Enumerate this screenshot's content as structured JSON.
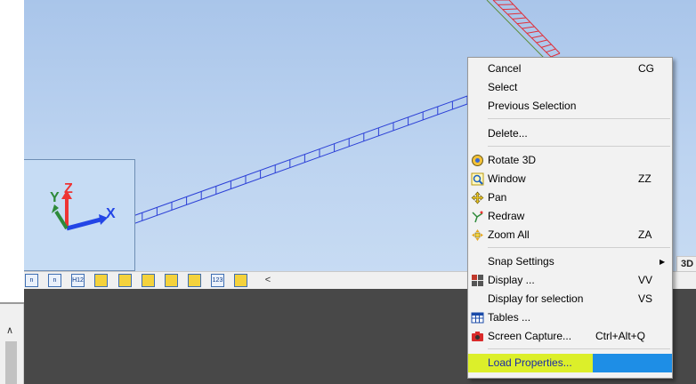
{
  "toolbar": {
    "buttons": [
      {
        "name": "dimension-left-tool",
        "text": "n"
      },
      {
        "name": "dimension-tool",
        "text": "n"
      },
      {
        "name": "h12-tool",
        "text": "H12"
      },
      {
        "name": "slab-tool",
        "text": ""
      },
      {
        "name": "brace-tool",
        "text": ""
      },
      {
        "name": "frame-tool",
        "text": ""
      },
      {
        "name": "plate-tool",
        "text": ""
      },
      {
        "name": "line-tool",
        "text": ""
      },
      {
        "name": "number-tool",
        "text": "123"
      },
      {
        "name": "grid-tool",
        "text": ""
      }
    ],
    "scroll_left": "<",
    "view_tab": "3D"
  },
  "axes": {
    "x": "X",
    "y": "Y",
    "z": "Z"
  },
  "context_menu": {
    "items": [
      {
        "label": "Cancel",
        "shortcut": "CG"
      },
      {
        "label": "Select",
        "shortcut": ""
      },
      {
        "label": "Previous Selection",
        "shortcut": ""
      },
      {
        "label": "Delete...",
        "shortcut": ""
      },
      {
        "label": "Rotate 3D",
        "shortcut": "",
        "icon": "rotate-3d-icon"
      },
      {
        "label": "Window",
        "shortcut": "ZZ",
        "icon": "zoom-window-icon"
      },
      {
        "label": "Pan",
        "shortcut": "",
        "icon": "pan-icon"
      },
      {
        "label": "Redraw",
        "shortcut": "",
        "icon": "redraw-icon"
      },
      {
        "label": "Zoom All",
        "shortcut": "ZA",
        "icon": "zoom-all-icon"
      },
      {
        "label": "Snap Settings",
        "shortcut": "",
        "submenu": true
      },
      {
        "label": "Display ...",
        "shortcut": "VV",
        "icon": "display-icon"
      },
      {
        "label": "Display for selection",
        "shortcut": "VS"
      },
      {
        "label": "Tables ...",
        "shortcut": "",
        "icon": "tables-icon"
      },
      {
        "label": "Screen Capture...",
        "shortcut": "Ctrl+Alt+Q",
        "icon": "camera-icon"
      },
      {
        "label": "Load Properties...",
        "shortcut": "",
        "highlighted": true
      }
    ]
  },
  "colors": {
    "menu_highlight": "#1e8ee6",
    "marker_yellow": "#dcef2a",
    "viewport_bg": "#b7cff0",
    "beam_blue": "#2b3fd6",
    "railing_red": "#e0303a"
  }
}
